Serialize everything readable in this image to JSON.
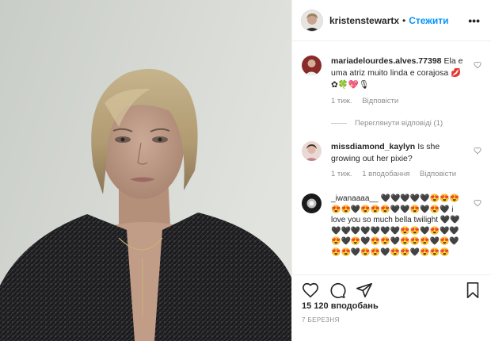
{
  "post": {
    "username": "kristenstewartx",
    "separator": "•",
    "follow_label": "Стежити",
    "more_label": "•••",
    "likes": "15 120 вподобань",
    "date": "7 БЕРЕЗНЯ"
  },
  "comments": [
    {
      "username": "mariadelourdes.alves.77398",
      "text": "Ela e uma atriz muito linda e corajosa 💋✿🍀💖🎙",
      "time": "1 тиж.",
      "likes": "",
      "reply_label": "Відповісти",
      "view_replies": "Переглянути відповіді (1)"
    },
    {
      "username": "missdiamond_kaylyn",
      "text": "Is she growing out her pixie?",
      "time": "1 тиж.",
      "likes": "1 вподобання",
      "reply_label": "Відповісти"
    },
    {
      "username": "_iwanaaaa__",
      "text": "🖤🖤🖤🖤🖤😍😍😍😍😍🖤😍😍😍🖤🖤😍🖤😍🖤 i love you so much bella twilight 🖤🖤🖤🖤🖤🖤🖤🖤🖤😍😍🖤😍🖤🖤😍🖤😍🖤😍😍🖤😍😍😍🖤😍🖤😍😍🖤😍😍🖤😍😍🖤😍😍😍"
    }
  ],
  "colors": {
    "link": "#0095f6",
    "muted": "#8e8e8e",
    "text": "#262626",
    "border": "#efefef"
  },
  "icons": [
    "heart-icon",
    "comment-icon",
    "share-icon",
    "bookmark-icon",
    "small-heart-icon",
    "more-icon"
  ]
}
